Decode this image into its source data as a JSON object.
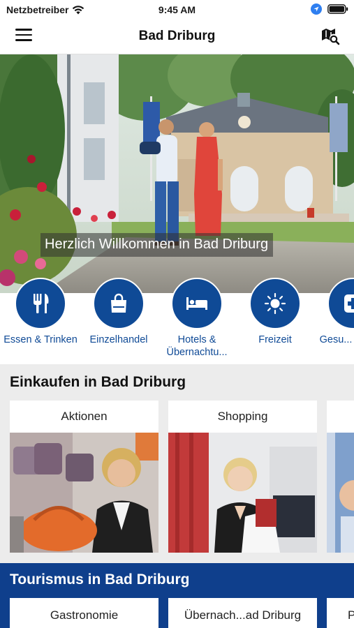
{
  "status_bar": {
    "carrier": "Netzbetreiber",
    "time": "9:45 AM"
  },
  "nav": {
    "title": "Bad Driburg",
    "menu_icon": "hamburger-menu-icon",
    "map_icon": "map-search-icon"
  },
  "hero": {
    "caption": "Herzlich Willkommen in Bad Driburg"
  },
  "categories": [
    {
      "label": "Essen & Trinken",
      "icon": "fork-knife-icon"
    },
    {
      "label": "Einzelhandel",
      "icon": "shopping-bag-icon"
    },
    {
      "label": "Hotels & Übernachtu...",
      "icon": "bed-icon"
    },
    {
      "label": "Freizeit",
      "icon": "sun-icon"
    },
    {
      "label": "Gesu... & Me...",
      "icon": "medical-cross-icon"
    }
  ],
  "section_shopping": {
    "title": "Einkaufen in Bad Driburg",
    "cards": [
      {
        "title": "Aktionen"
      },
      {
        "title": "Shopping"
      }
    ]
  },
  "section_tourism": {
    "title": "Tourismus in Bad Driburg",
    "cards": [
      {
        "title": "Gastronomie"
      },
      {
        "title": "Übernach...ad Driburg"
      },
      {
        "title": "P"
      }
    ]
  },
  "colors": {
    "brand_blue": "#0f4a96",
    "tourism_band": "#0f3f8c",
    "section_bg": "#ececec"
  }
}
